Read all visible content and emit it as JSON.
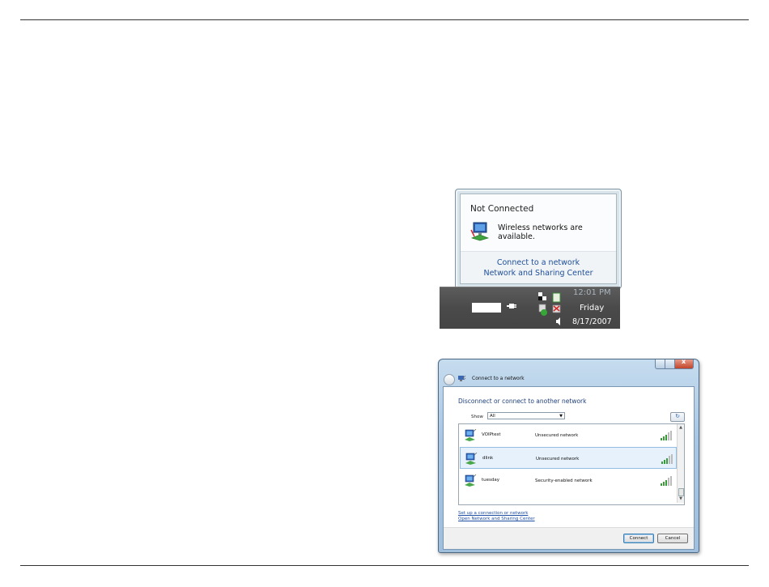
{
  "balloon": {
    "title": "Not Connected",
    "message": "Wireless networks are available.",
    "links": [
      "Connect to a network",
      "Network and Sharing Center"
    ],
    "icon": "network-icon"
  },
  "taskbar": {
    "time": "12:01 PM",
    "day": "Friday",
    "date": "8/17/2007"
  },
  "window": {
    "title": "Connect to a network",
    "heading": "Disconnect or connect to another network",
    "show_label": "Show",
    "show_value": "All",
    "networks": [
      {
        "name": "VOIPtest",
        "type": "Unsecured network",
        "selected": false
      },
      {
        "name": "dlink",
        "type": "Unsecured network",
        "selected": true
      },
      {
        "name": "tuesday",
        "type": "Security-enabled network",
        "selected": false
      }
    ],
    "links": [
      "Set up a connection or network",
      "Open Network and Sharing Center"
    ],
    "connect_label": "Connect",
    "cancel_label": "Cancel"
  },
  "colors": {
    "link": "#1f4fa3",
    "heading": "#1e3f7a",
    "selection": "#e6f1fb"
  }
}
